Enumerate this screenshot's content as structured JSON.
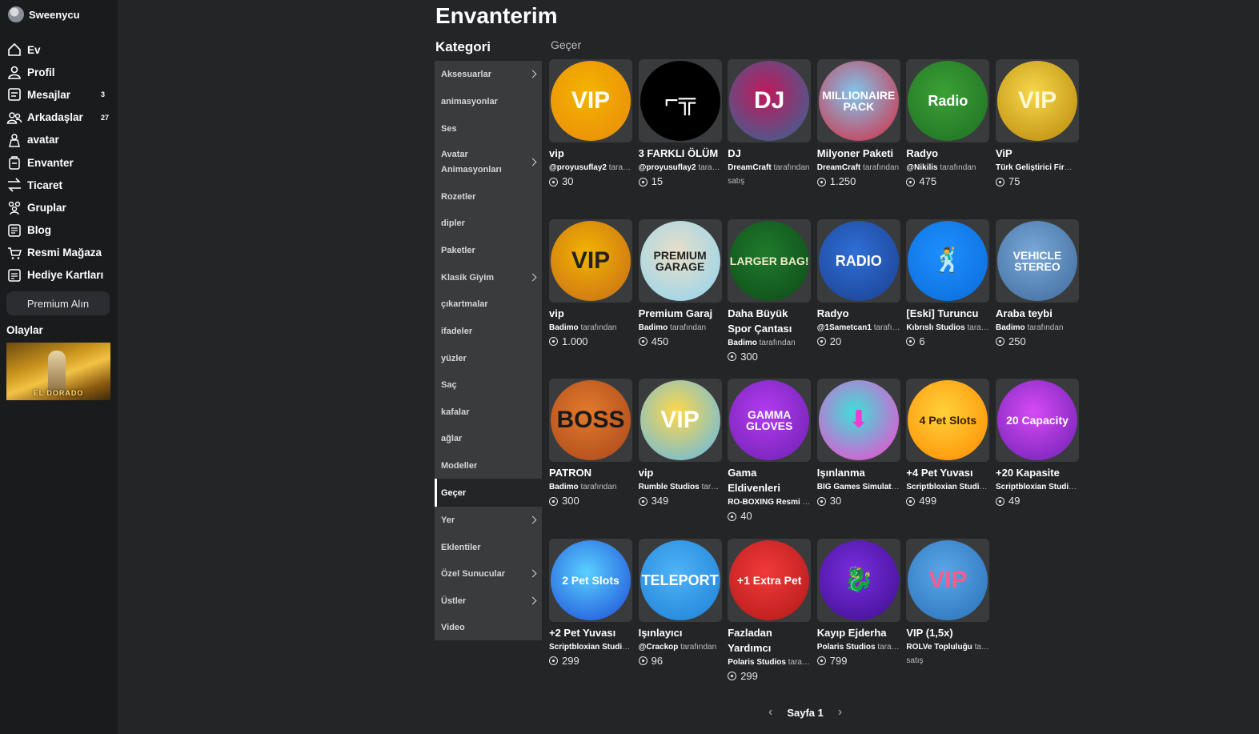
{
  "user": {
    "name": "Sweenycu"
  },
  "nav": [
    {
      "label": "Ev",
      "icon": "home-icon"
    },
    {
      "label": "Profil",
      "icon": "profile-icon"
    },
    {
      "label": "Mesajlar",
      "icon": "messages-icon",
      "badge": "3"
    },
    {
      "label": "Arkadaşlar",
      "icon": "friends-icon",
      "badge": "27"
    },
    {
      "label": "avatar",
      "icon": "avatar-icon"
    },
    {
      "label": "Envanter",
      "icon": "inventory-icon"
    },
    {
      "label": "Ticaret",
      "icon": "trade-icon"
    },
    {
      "label": "Gruplar",
      "icon": "groups-icon"
    },
    {
      "label": "Blog",
      "icon": "blog-icon"
    },
    {
      "label": "Resmi Mağaza",
      "icon": "store-icon"
    },
    {
      "label": "Hediye Kartları",
      "icon": "gift-card-icon"
    }
  ],
  "premium_label": "Premium Alın",
  "events": {
    "title": "Olaylar",
    "banner_text": "EL DORADO"
  },
  "page_title": "Envanterim",
  "category_title": "Kategori",
  "subtitle": "Geçer",
  "categories": [
    {
      "label": "Aksesuarlar",
      "chevron": true
    },
    {
      "label": "animasyonlar",
      "chevron": false
    },
    {
      "label": "Ses",
      "chevron": false
    },
    {
      "label": "Avatar Animasyonları",
      "chevron": true
    },
    {
      "label": "Rozetler",
      "chevron": false
    },
    {
      "label": "dipler",
      "chevron": false
    },
    {
      "label": "Paketler",
      "chevron": false
    },
    {
      "label": "Klasik Giyim",
      "chevron": true
    },
    {
      "label": "çıkartmalar",
      "chevron": false
    },
    {
      "label": "ifadeler",
      "chevron": false
    },
    {
      "label": "yüzler",
      "chevron": false
    },
    {
      "label": "Saç",
      "chevron": false
    },
    {
      "label": "kafalar",
      "chevron": false
    },
    {
      "label": "ağlar",
      "chevron": false
    },
    {
      "label": "Modeller",
      "chevron": false
    },
    {
      "label": "Geçer",
      "chevron": false,
      "active": true
    },
    {
      "label": "Yer",
      "chevron": true
    },
    {
      "label": "Eklentiler",
      "chevron": false
    },
    {
      "label": "Özel Sunucular",
      "chevron": true
    },
    {
      "label": "Üstler",
      "chevron": true
    },
    {
      "label": "Video",
      "chevron": false
    }
  ],
  "creator_suffix": "tarafından",
  "items": [
    {
      "name": "vip",
      "creator": "@proyusuflay2",
      "price": "30",
      "thumb": "VIP",
      "colors": [
        "#f4b400",
        "#e8890b"
      ],
      "text_color": "#fff"
    },
    {
      "name": "3 FARKLI ÖLÜM",
      "creator": "@proyusuflay2",
      "price": "15",
      "thumb": "⌐╦",
      "colors": [
        "#000000",
        "#000000"
      ],
      "text_color": "#fff"
    },
    {
      "name": "DJ",
      "creator": "DreamCraft",
      "sale": "satış",
      "thumb": "DJ",
      "colors": [
        "#c2185b",
        "#2d6b9a"
      ],
      "text_color": "#fff"
    },
    {
      "name": "Milyoner Paketi",
      "creator": "DreamCraft",
      "price": "1.250",
      "thumb": "MILLIONAIRE PACK",
      "colors": [
        "#7fc6ef",
        "#d8263a"
      ],
      "text_color": "#fff"
    },
    {
      "name": "Radyo",
      "creator": "@Nikilis",
      "price": "475",
      "thumb": "Radio",
      "colors": [
        "#3aa135",
        "#1f6e22"
      ],
      "text_color": "#fff"
    },
    {
      "name": "ViP",
      "creator": "Türk Geliştirici Firması",
      "price": "75",
      "thumb": "VIP",
      "colors": [
        "#f7d84a",
        "#b8860b"
      ],
      "text_color": "#fff8d0"
    },
    {
      "name": "vip",
      "creator": "Badimo",
      "price": "1.000",
      "thumb": "VIP",
      "colors": [
        "#f4b400",
        "#c46a1a"
      ],
      "text_color": "#222"
    },
    {
      "name": "Premium Garaj",
      "creator": "Badimo",
      "price": "450",
      "thumb": "PREMIUM GARAGE",
      "colors": [
        "#e9dfc8",
        "#8fd3f0"
      ],
      "text_color": "#222"
    },
    {
      "name": "Daha Büyük Spor Çantası",
      "creator": "Badimo",
      "price": "300",
      "thumb": "LARGER BAG!",
      "colors": [
        "#1f7a2c",
        "#0d4a17"
      ],
      "text_color": "#f2e8c9"
    },
    {
      "name": "Radyo",
      "creator": "@1Sametcan1",
      "price": "20",
      "thumb": "RADIO",
      "colors": [
        "#2f6fd6",
        "#1a3f8f"
      ],
      "text_color": "#fff"
    },
    {
      "name": "[Eski] Turuncu",
      "creator": "Kıbrıslı Studios",
      "price": "6",
      "thumb": "🕺",
      "colors": [
        "#1e90ff",
        "#0a6ad9"
      ],
      "text_color": "#fff"
    },
    {
      "name": "Araba teybi",
      "creator": "Badimo",
      "price": "250",
      "thumb": "VEHICLE STEREO",
      "colors": [
        "#7aa8d8",
        "#3d6a9a"
      ],
      "text_color": "#fff"
    },
    {
      "name": "PATRON",
      "creator": "Badimo",
      "price": "300",
      "thumb": "BOSS",
      "colors": [
        "#e37a2c",
        "#a8461a"
      ],
      "text_color": "#1a1a1a"
    },
    {
      "name": "vip",
      "creator": "Rumble Studios",
      "price": "349",
      "thumb": "VIP",
      "colors": [
        "#ffd84a",
        "#5bb7f0"
      ],
      "text_color": "#fff"
    },
    {
      "name": "Gama Eldivenleri",
      "creator": "RO-BOXING Resmi",
      "price": "40",
      "thumb": "GAMMA GLOVES",
      "colors": [
        "#b23cf0",
        "#6d1fb0"
      ],
      "text_color": "#fff"
    },
    {
      "name": "Işınlanma",
      "creator": "BIG Games Simulator",
      "price": "30",
      "thumb": "⬇",
      "colors": [
        "#3ee0d8",
        "#ff3ecf"
      ],
      "text_color": "#e83fd0"
    },
    {
      "name": "+4 Pet Yuvası",
      "creator": "Scriptbloxian Studios",
      "price": "499",
      "thumb": "4 Pet Slots",
      "colors": [
        "#ffd23a",
        "#ff8a00"
      ],
      "text_color": "#3a1d00"
    },
    {
      "name": "+20 Kapasite",
      "creator": "Scriptbloxian Studios",
      "price": "49",
      "thumb": "20 Capacity",
      "colors": [
        "#d64bf5",
        "#6b1fb2"
      ],
      "text_color": "#fff"
    },
    {
      "name": "+2 Pet Yuvası",
      "creator": "Scriptbloxian Studios",
      "price": "299",
      "thumb": "2 Pet Slots",
      "colors": [
        "#5ad0ff",
        "#1b4ad6"
      ],
      "text_color": "#fff"
    },
    {
      "name": "Işınlayıcı",
      "creator": "@Crackop",
      "price": "96",
      "thumb": "TELEPORT",
      "colors": [
        "#4fb3f7",
        "#1c7fd6"
      ],
      "text_color": "#fff"
    },
    {
      "name": "Fazladan Yardımcı",
      "creator": "Polaris Studios",
      "price": "299",
      "thumb": "+1 Extra Pet",
      "colors": [
        "#f23a3a",
        "#b01818"
      ],
      "text_color": "#fff"
    },
    {
      "name": "Kayıp Ejderha",
      "creator": "Polaris Studios",
      "price": "799",
      "thumb": "🐉",
      "colors": [
        "#7a2de0",
        "#3d0e8c"
      ],
      "text_color": "#1a0530"
    },
    {
      "name": "VIP (1,5x)",
      "creator": "ROLVe Topluluğu",
      "sale": "satış",
      "thumb": "VIP",
      "colors": [
        "#5aa7e8",
        "#2a6fb8"
      ],
      "text_color": "#ff5a8a"
    }
  ],
  "pager": {
    "label": "Sayfa 1"
  }
}
